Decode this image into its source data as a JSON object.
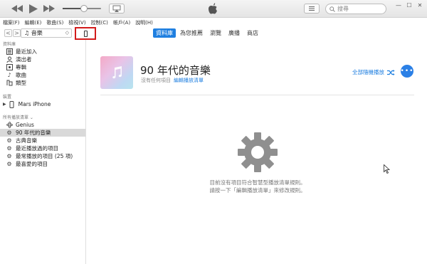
{
  "window": {
    "controls": {
      "minimize": "—",
      "maximize": "☐",
      "close": "✕"
    },
    "search_placeholder": "搜尋",
    "icons": [
      "rewind-icon",
      "play-icon",
      "fast-forward-icon",
      "volume-slider",
      "airplay-icon",
      "apple-logo-icon",
      "list-view-icon",
      "search-icon"
    ],
    "volume": 0.55
  },
  "menu": [
    "檔案(F)",
    "編輯(E)",
    "歌曲(S)",
    "檢視(V)",
    "控制(C)",
    "帳戶(A)",
    "說明(H)"
  ],
  "nav": {
    "back": "<",
    "forward": ">",
    "media_selector": "音樂",
    "tabs": [
      "資料庫",
      "為您推薦",
      "瀏覽",
      "廣播",
      "商店"
    ],
    "active_tab_index": 0
  },
  "sidebar": {
    "library_header": "資料庫",
    "library_items": [
      "最近加入",
      "演出者",
      "專輯",
      "歌曲",
      "類型"
    ],
    "devices_header": "裝置",
    "device_name": "Mars iPhone",
    "playlists_header": "所有播放清單 ⌄",
    "playlists": [
      "Genius",
      "90 年代的音樂",
      "古典音樂",
      "最近播放過的項目",
      "最常播放的項目 (25 項)",
      "最喜愛的項目"
    ],
    "selected_playlist_index": 1
  },
  "main": {
    "playlist_title": "90 年代的音樂",
    "playlist_subtitle": "沒有任何項目",
    "edit_link": "編輯播放清單",
    "shuffle_all": "全部隨機播放",
    "more_button": "•••",
    "empty_line1": "目前沒有項目符合智慧型播放清單規則。",
    "empty_line2": "請按一下「編輯播放清單」來修改規則。"
  },
  "colors": {
    "accent": "#1f7fe0",
    "highlight_border": "#d21b1b",
    "selected_row": "#d9d9d9"
  }
}
